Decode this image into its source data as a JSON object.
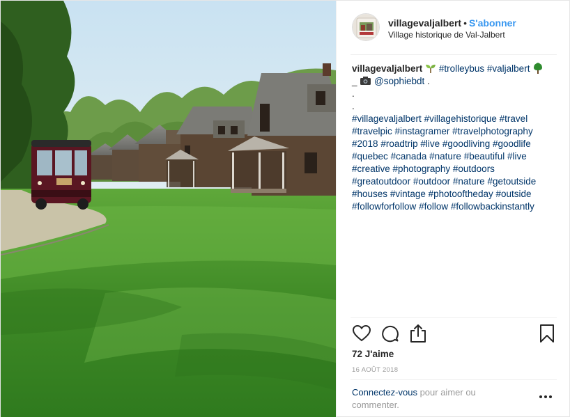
{
  "post": {
    "username": "villagevaljalbert",
    "separator": "•",
    "follow_label": "S'abonner",
    "location": "Village historique de Val-Jalbert",
    "photo_alt": "photo"
  },
  "caption": {
    "username": "villagevaljalbert",
    "line1_tags": [
      "#trolleybus",
      "#valjalbert"
    ],
    "line2_prefix": "_",
    "mention": "@sophiebdt",
    "line2_suffix": ".",
    "dot1": ".",
    "dot2": ".",
    "hashtags": [
      "#villagevaljalbert",
      "#villagehistorique",
      "#travel",
      "#travelpic",
      "#instagramer",
      "#travelphotography",
      "#2018",
      "#roadtrip",
      "#live",
      "#goodliving",
      "#goodlife",
      "#quebec",
      "#canada",
      "#nature",
      "#beautiful",
      "#live",
      "#creative",
      "#photography",
      "#outdoors",
      "#greatoutdoor",
      "#outdoor",
      "#nature",
      "#getoutside",
      "#houses",
      "#vintage",
      "#photooftheday",
      "#outside",
      "#followforfollow",
      "#follow",
      "#followbackinstantly"
    ],
    "emoji": [
      "seedling",
      "deciduous-tree",
      "camera"
    ]
  },
  "engagement": {
    "likes": "72 J'aime",
    "date": "16 AOÛT 2018"
  },
  "login_prompt": {
    "link": "Connectez-vous",
    "rest": " pour aimer ou commenter."
  },
  "icons": [
    "heart-icon",
    "comment-icon",
    "share-icon",
    "bookmark-icon",
    "more-options-icon"
  ],
  "colors": {
    "link_blue": "#3897f0",
    "hashtag": "#003569",
    "text": "#262626",
    "muted": "#999999",
    "divider": "#efefef"
  }
}
